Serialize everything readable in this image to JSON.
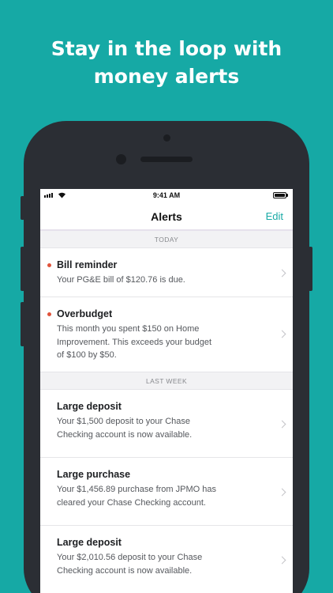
{
  "headline": {
    "line1": "Stay in the loop with",
    "line2": "money alerts"
  },
  "status_bar": {
    "time": "9:41 AM",
    "icons": [
      "signal-icon",
      "wifi-icon",
      "battery-icon"
    ]
  },
  "nav": {
    "title": "Alerts",
    "edit_label": "Edit"
  },
  "sections": [
    {
      "header": "TODAY",
      "items": [
        {
          "title": "Bill reminder",
          "desc_lines": [
            "Your PG&E bill of $120.76 is due."
          ],
          "unread": true
        },
        {
          "title": "Overbudget",
          "desc_lines": [
            "This month you spent $150 on Home",
            "Improvement. This exceeds your budget",
            "of $100 by $50."
          ],
          "unread": true
        }
      ]
    },
    {
      "header": "LAST WEEK",
      "items": [
        {
          "title": "Large deposit",
          "desc_lines": [
            "Your $1,500 deposit to your Chase",
            "Checking account is now available."
          ],
          "unread": false
        },
        {
          "title": "Large purchase",
          "desc_lines": [
            "Your $1,456.89 purchase from JPMO has",
            "cleared your Chase Checking account."
          ],
          "unread": false
        },
        {
          "title": "Large deposit",
          "desc_lines": [
            "Your $2,010.56 deposit to your Chase",
            "Checking account is now available."
          ],
          "unread": false
        }
      ]
    }
  ],
  "colors": {
    "background": "#16a9a5",
    "accent": "#19aaa6",
    "unread_dot": "#e0533b"
  }
}
